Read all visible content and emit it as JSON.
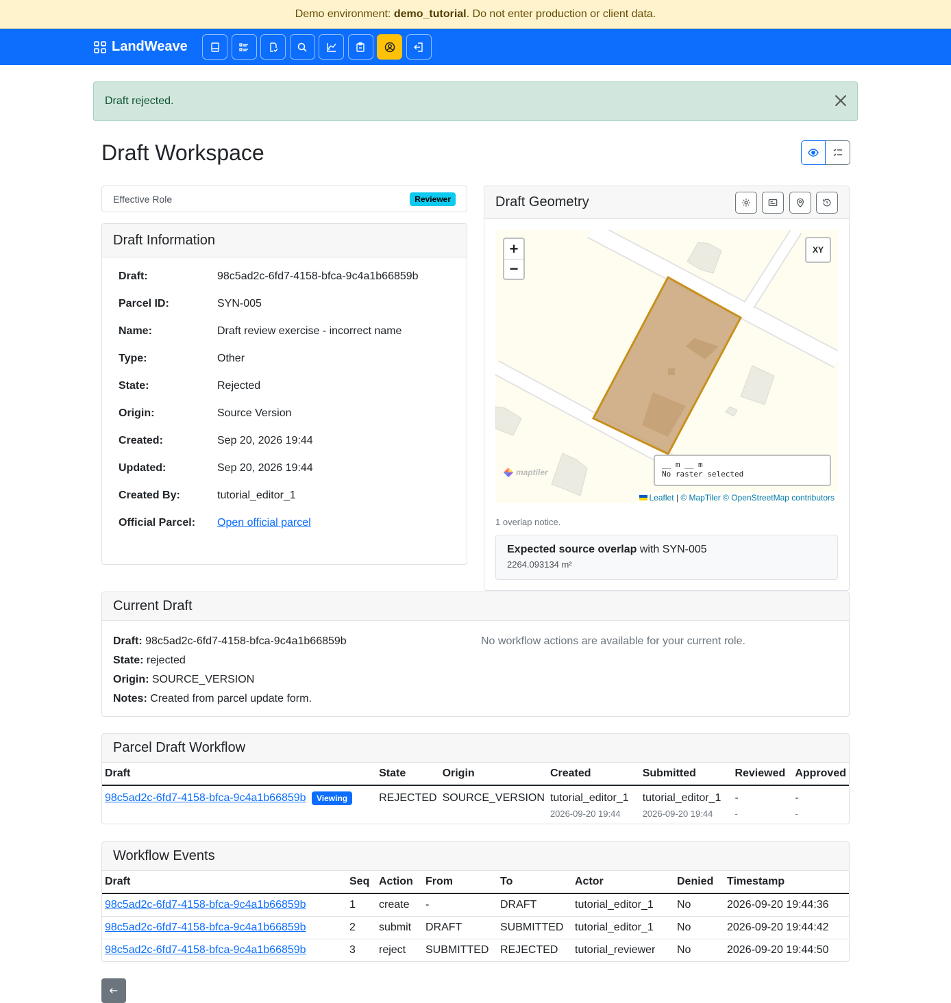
{
  "banner": {
    "prefix": "Demo environment: ",
    "env": "demo_tutorial",
    "suffix": ". Do not enter production or client data."
  },
  "nav": {
    "brand": "LandWeave",
    "icons": [
      "book-icon",
      "list-icon",
      "document-check-icon",
      "search-icon",
      "chart-icon",
      "clipboard-icon",
      "user-circle-icon",
      "logout-icon"
    ],
    "active_index": 6
  },
  "alert": {
    "message": "Draft rejected."
  },
  "page": {
    "title": "Draft Workspace"
  },
  "role": {
    "label": "Effective Role",
    "value": "Reviewer"
  },
  "info": {
    "header": "Draft Information",
    "rows": [
      {
        "k": "Draft:",
        "v": "98c5ad2c-6fd7-4158-bfca-9c4a1b66859b"
      },
      {
        "k": "Parcel ID:",
        "v": "SYN-005"
      },
      {
        "k": "Name:",
        "v": "Draft review exercise - incorrect name"
      },
      {
        "k": "Type:",
        "v": "Other"
      },
      {
        "k": "State:",
        "v": "Rejected"
      },
      {
        "k": "Origin:",
        "v": "Source Version"
      },
      {
        "k": "Created:",
        "v": "Sep 20, 2026 19:44"
      },
      {
        "k": "Updated:",
        "v": "Sep 20, 2026 19:44"
      },
      {
        "k": "Created By:",
        "v": "tutorial_editor_1"
      },
      {
        "k": "Official Parcel:",
        "link": "Open official parcel"
      }
    ]
  },
  "geometry": {
    "header": "Draft Geometry",
    "tool_icons": [
      "gear-icon",
      "card-icon",
      "map-pin-icon",
      "history-icon"
    ],
    "map": {
      "zoom_in": "+",
      "zoom_out": "−",
      "xy": "XY",
      "scale_line": "__ m __ m",
      "raster": "No raster selected",
      "logo": "maptiler",
      "attrib_leaflet": "Leaflet",
      "attrib_sep": " | ",
      "attrib_maptiler": "© MapTiler",
      "attrib_osm": "© OpenStreetMap contributors"
    },
    "overlap_count": "1 overlap notice.",
    "overlap": {
      "title": "Expected source overlap",
      "with": " with SYN-005",
      "area": "2264.093134 m²"
    }
  },
  "current": {
    "header": "Current Draft",
    "items": [
      {
        "k": "Draft:",
        "v": " 98c5ad2c-6fd7-4158-bfca-9c4a1b66859b"
      },
      {
        "k": "State:",
        "v": " rejected"
      },
      {
        "k": "Origin:",
        "v": " SOURCE_VERSION"
      },
      {
        "k": "Notes:",
        "v": " Created from parcel update form."
      }
    ],
    "note": "No workflow actions are available for your current role."
  },
  "workflow": {
    "header": "Parcel Draft Workflow",
    "columns": [
      "Draft",
      "State",
      "Origin",
      "Created",
      "Submitted",
      "Reviewed",
      "Approved"
    ],
    "row": {
      "draft": "98c5ad2c-6fd7-4158-bfca-9c4a1b66859b",
      "badge": "Viewing",
      "state": "REJECTED",
      "origin": "SOURCE_VERSION",
      "created_by": "tutorial_editor_1",
      "created_at": "2026-09-20 19:44",
      "submitted_by": "tutorial_editor_1",
      "submitted_at": "2026-09-20 19:44",
      "reviewed": "-",
      "reviewed_at": "-",
      "approved": "-",
      "approved_at": "-"
    }
  },
  "events": {
    "header": "Workflow Events",
    "columns": [
      "Draft",
      "Seq",
      "Action",
      "From",
      "To",
      "Actor",
      "Denied",
      "Timestamp"
    ],
    "rows": [
      {
        "draft": "98c5ad2c-6fd7-4158-bfca-9c4a1b66859b",
        "seq": "1",
        "action": "create",
        "from": "-",
        "to": "DRAFT",
        "actor": "tutorial_editor_1",
        "denied": "No",
        "ts": "2026-09-20 19:44:36"
      },
      {
        "draft": "98c5ad2c-6fd7-4158-bfca-9c4a1b66859b",
        "seq": "2",
        "action": "submit",
        "from": "DRAFT",
        "to": "SUBMITTED",
        "actor": "tutorial_editor_1",
        "denied": "No",
        "ts": "2026-09-20 19:44:42"
      },
      {
        "draft": "98c5ad2c-6fd7-4158-bfca-9c4a1b66859b",
        "seq": "3",
        "action": "reject",
        "from": "SUBMITTED",
        "to": "REJECTED",
        "actor": "tutorial_reviewer",
        "denied": "No",
        "ts": "2026-09-20 19:44:50"
      }
    ]
  },
  "colors": {
    "primary": "#0d6efd",
    "warning": "#ffc107",
    "info": "#0dcaf0",
    "success_bg": "#d1e7dd",
    "parcel_stroke": "#c8901e"
  }
}
